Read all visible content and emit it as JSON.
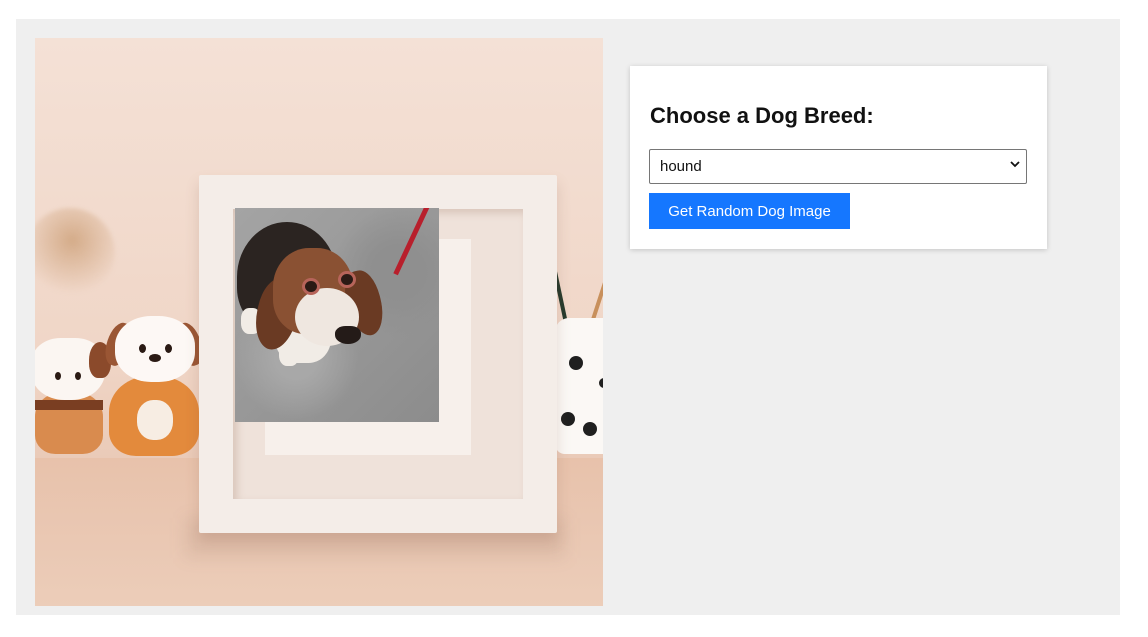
{
  "panel": {
    "title": "Choose a Dog Breed:",
    "breed_select": {
      "selected": "hound",
      "options": [
        "hound"
      ]
    },
    "fetch_button_label": "Get Random Dog Image"
  },
  "image": {
    "description_icon": "dog-photo-in-frame"
  },
  "colors": {
    "background": "#efefef",
    "panel": "#ffffff",
    "button": "#1577ff",
    "button_text": "#ffffff"
  }
}
